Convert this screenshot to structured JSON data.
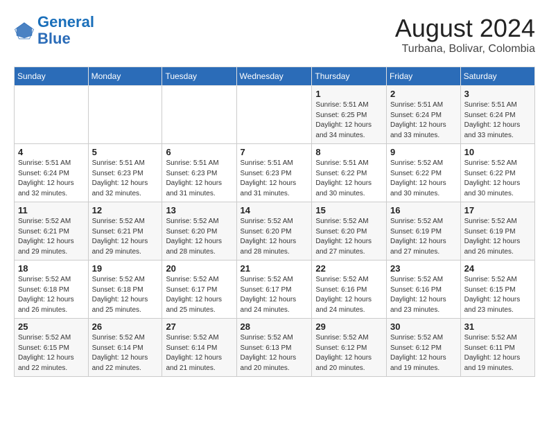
{
  "header": {
    "logo_line1": "General",
    "logo_line2": "Blue",
    "month_year": "August 2024",
    "location": "Turbana, Bolivar, Colombia"
  },
  "weekdays": [
    "Sunday",
    "Monday",
    "Tuesday",
    "Wednesday",
    "Thursday",
    "Friday",
    "Saturday"
  ],
  "weeks": [
    [
      {
        "day": "",
        "info": ""
      },
      {
        "day": "",
        "info": ""
      },
      {
        "day": "",
        "info": ""
      },
      {
        "day": "",
        "info": ""
      },
      {
        "day": "1",
        "info": "Sunrise: 5:51 AM\nSunset: 6:25 PM\nDaylight: 12 hours\nand 34 minutes."
      },
      {
        "day": "2",
        "info": "Sunrise: 5:51 AM\nSunset: 6:24 PM\nDaylight: 12 hours\nand 33 minutes."
      },
      {
        "day": "3",
        "info": "Sunrise: 5:51 AM\nSunset: 6:24 PM\nDaylight: 12 hours\nand 33 minutes."
      }
    ],
    [
      {
        "day": "4",
        "info": "Sunrise: 5:51 AM\nSunset: 6:24 PM\nDaylight: 12 hours\nand 32 minutes."
      },
      {
        "day": "5",
        "info": "Sunrise: 5:51 AM\nSunset: 6:23 PM\nDaylight: 12 hours\nand 32 minutes."
      },
      {
        "day": "6",
        "info": "Sunrise: 5:51 AM\nSunset: 6:23 PM\nDaylight: 12 hours\nand 31 minutes."
      },
      {
        "day": "7",
        "info": "Sunrise: 5:51 AM\nSunset: 6:23 PM\nDaylight: 12 hours\nand 31 minutes."
      },
      {
        "day": "8",
        "info": "Sunrise: 5:51 AM\nSunset: 6:22 PM\nDaylight: 12 hours\nand 30 minutes."
      },
      {
        "day": "9",
        "info": "Sunrise: 5:52 AM\nSunset: 6:22 PM\nDaylight: 12 hours\nand 30 minutes."
      },
      {
        "day": "10",
        "info": "Sunrise: 5:52 AM\nSunset: 6:22 PM\nDaylight: 12 hours\nand 30 minutes."
      }
    ],
    [
      {
        "day": "11",
        "info": "Sunrise: 5:52 AM\nSunset: 6:21 PM\nDaylight: 12 hours\nand 29 minutes."
      },
      {
        "day": "12",
        "info": "Sunrise: 5:52 AM\nSunset: 6:21 PM\nDaylight: 12 hours\nand 29 minutes."
      },
      {
        "day": "13",
        "info": "Sunrise: 5:52 AM\nSunset: 6:20 PM\nDaylight: 12 hours\nand 28 minutes."
      },
      {
        "day": "14",
        "info": "Sunrise: 5:52 AM\nSunset: 6:20 PM\nDaylight: 12 hours\nand 28 minutes."
      },
      {
        "day": "15",
        "info": "Sunrise: 5:52 AM\nSunset: 6:20 PM\nDaylight: 12 hours\nand 27 minutes."
      },
      {
        "day": "16",
        "info": "Sunrise: 5:52 AM\nSunset: 6:19 PM\nDaylight: 12 hours\nand 27 minutes."
      },
      {
        "day": "17",
        "info": "Sunrise: 5:52 AM\nSunset: 6:19 PM\nDaylight: 12 hours\nand 26 minutes."
      }
    ],
    [
      {
        "day": "18",
        "info": "Sunrise: 5:52 AM\nSunset: 6:18 PM\nDaylight: 12 hours\nand 26 minutes."
      },
      {
        "day": "19",
        "info": "Sunrise: 5:52 AM\nSunset: 6:18 PM\nDaylight: 12 hours\nand 25 minutes."
      },
      {
        "day": "20",
        "info": "Sunrise: 5:52 AM\nSunset: 6:17 PM\nDaylight: 12 hours\nand 25 minutes."
      },
      {
        "day": "21",
        "info": "Sunrise: 5:52 AM\nSunset: 6:17 PM\nDaylight: 12 hours\nand 24 minutes."
      },
      {
        "day": "22",
        "info": "Sunrise: 5:52 AM\nSunset: 6:16 PM\nDaylight: 12 hours\nand 24 minutes."
      },
      {
        "day": "23",
        "info": "Sunrise: 5:52 AM\nSunset: 6:16 PM\nDaylight: 12 hours\nand 23 minutes."
      },
      {
        "day": "24",
        "info": "Sunrise: 5:52 AM\nSunset: 6:15 PM\nDaylight: 12 hours\nand 23 minutes."
      }
    ],
    [
      {
        "day": "25",
        "info": "Sunrise: 5:52 AM\nSunset: 6:15 PM\nDaylight: 12 hours\nand 22 minutes."
      },
      {
        "day": "26",
        "info": "Sunrise: 5:52 AM\nSunset: 6:14 PM\nDaylight: 12 hours\nand 22 minutes."
      },
      {
        "day": "27",
        "info": "Sunrise: 5:52 AM\nSunset: 6:14 PM\nDaylight: 12 hours\nand 21 minutes."
      },
      {
        "day": "28",
        "info": "Sunrise: 5:52 AM\nSunset: 6:13 PM\nDaylight: 12 hours\nand 20 minutes."
      },
      {
        "day": "29",
        "info": "Sunrise: 5:52 AM\nSunset: 6:12 PM\nDaylight: 12 hours\nand 20 minutes."
      },
      {
        "day": "30",
        "info": "Sunrise: 5:52 AM\nSunset: 6:12 PM\nDaylight: 12 hours\nand 19 minutes."
      },
      {
        "day": "31",
        "info": "Sunrise: 5:52 AM\nSunset: 6:11 PM\nDaylight: 12 hours\nand 19 minutes."
      }
    ]
  ]
}
